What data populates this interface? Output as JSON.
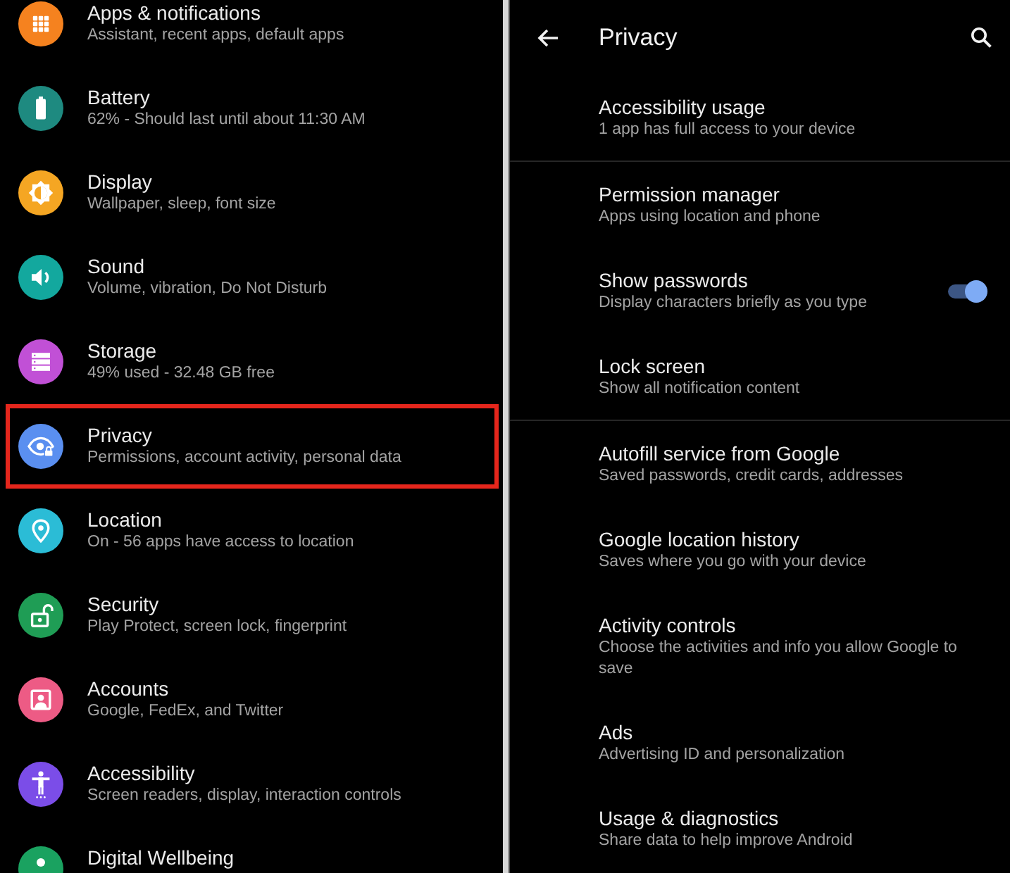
{
  "settings_list": {
    "items": [
      {
        "title": "Apps & notifications",
        "subtitle": "Assistant, recent apps, default apps",
        "color": "#f5821f",
        "highlighted": false
      },
      {
        "title": "Battery",
        "subtitle": "62% - Should last until about 11:30 AM",
        "color": "#1e8a80",
        "highlighted": false
      },
      {
        "title": "Display",
        "subtitle": "Wallpaper, sleep, font size",
        "color": "#f5a623",
        "highlighted": false
      },
      {
        "title": "Sound",
        "subtitle": "Volume, vibration, Do Not Disturb",
        "color": "#13a89e",
        "highlighted": false
      },
      {
        "title": "Storage",
        "subtitle": "49% used - 32.48 GB free",
        "color": "#c150d6",
        "highlighted": false
      },
      {
        "title": "Privacy",
        "subtitle": "Permissions, account activity, personal data",
        "color": "#5a8ff0",
        "highlighted": true
      },
      {
        "title": "Location",
        "subtitle": "On - 56 apps have access to location",
        "color": "#2bbcd6",
        "highlighted": false
      },
      {
        "title": "Security",
        "subtitle": "Play Protect, screen lock, fingerprint",
        "color": "#1f9d55",
        "highlighted": false
      },
      {
        "title": "Accounts",
        "subtitle": "Google, FedEx, and Twitter",
        "color": "#ed5b85",
        "highlighted": false
      },
      {
        "title": "Accessibility",
        "subtitle": "Screen readers, display, interaction controls",
        "color": "#7b4de8",
        "highlighted": false
      },
      {
        "title": "Digital Wellbeing",
        "color": "#1aa260",
        "highlighted": false
      }
    ]
  },
  "privacy_screen": {
    "title": "Privacy",
    "sections": [
      {
        "items": [
          {
            "kind": "plain",
            "title": "Accessibility usage",
            "subtitle": "1 app has full access to your device"
          }
        ]
      },
      {
        "items": [
          {
            "kind": "plain",
            "title": "Permission manager",
            "subtitle": "Apps using location and phone"
          },
          {
            "kind": "switch",
            "title": "Show passwords",
            "subtitle": "Display characters briefly as you type",
            "on": true
          },
          {
            "kind": "plain",
            "title": "Lock screen",
            "subtitle": "Show all notification content"
          }
        ]
      },
      {
        "items": [
          {
            "kind": "plain",
            "title": "Autofill service from Google",
            "subtitle": "Saved passwords, credit cards, addresses"
          },
          {
            "kind": "plain",
            "title": "Google location history",
            "subtitle": "Saves where you go with your device"
          },
          {
            "kind": "plain",
            "title": "Activity controls",
            "subtitle": "Choose the activities and info you allow Google to save"
          },
          {
            "kind": "plain",
            "title": "Ads",
            "subtitle": "Advertising ID and personalization"
          },
          {
            "kind": "plain",
            "title": "Usage & diagnostics",
            "subtitle": "Share data to help improve Android"
          }
        ]
      }
    ]
  }
}
